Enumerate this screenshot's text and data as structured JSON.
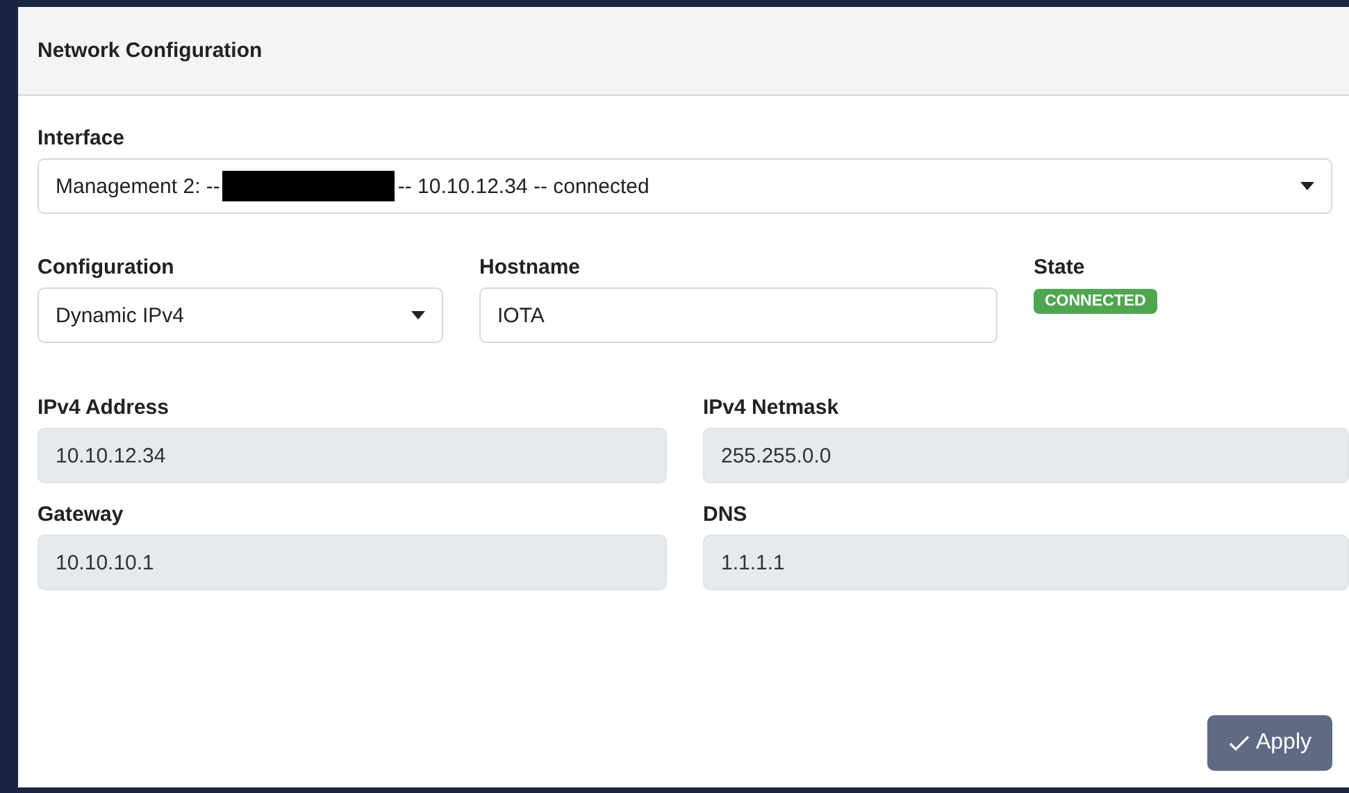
{
  "panel": {
    "title": "Network Configuration"
  },
  "interface": {
    "label": "Interface",
    "value_before": "Management 2: --",
    "redacted": true,
    "value_after": "-- 10.10.12.34 -- connected"
  },
  "configuration": {
    "label": "Configuration",
    "value": "Dynamic IPv4"
  },
  "hostname": {
    "label": "Hostname",
    "value": "IOTA",
    "disabled": false
  },
  "state": {
    "label": "State",
    "badge": "CONNECTED",
    "color": "#4ea74f"
  },
  "fields": [
    {
      "label": "IPv4 Address",
      "value": "10.10.12.34",
      "disabled": true
    },
    {
      "label": "IPv4 Netmask",
      "value": "255.255.0.0",
      "disabled": true
    },
    {
      "label": "Gateway",
      "value": "10.10.10.1",
      "disabled": true
    },
    {
      "label": "DNS",
      "value": "1.1.1.1",
      "disabled": true
    }
  ],
  "apply_button": {
    "label": "Apply"
  }
}
